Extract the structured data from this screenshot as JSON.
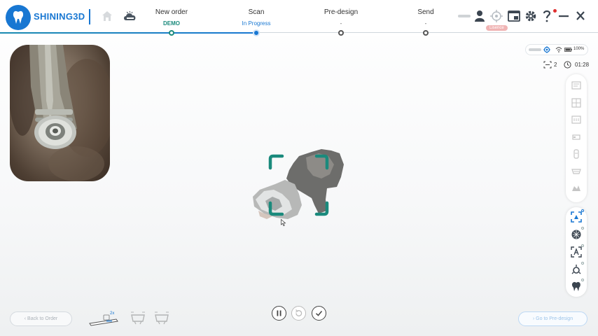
{
  "app": {
    "brand": "SHINING3D"
  },
  "steps": [
    {
      "title": "New order",
      "sub": "DEMO"
    },
    {
      "title": "Scan",
      "sub": "In Progress"
    },
    {
      "title": "Pre-design",
      "sub": "-"
    },
    {
      "title": "Send",
      "sub": "-"
    }
  ],
  "header": {
    "badge_text": "Lisence"
  },
  "status": {
    "battery_percent": "100%",
    "scan_count": "2",
    "timer": "01:28"
  },
  "scanner": {
    "zoom_level": "2x"
  },
  "buttons": {
    "back": "Back to Order",
    "next": "Go to Pre-design"
  },
  "colors": {
    "brand": "#1877d2",
    "accent_teal": "#1a8a7c",
    "scan_frame": "#1a8a7c"
  },
  "icons": {
    "topbar": [
      "home-icon",
      "cloud-icon",
      "device-icon",
      "user-icon",
      "calibration-icon",
      "screen-icon",
      "gear-icon",
      "help-icon",
      "minimize-icon",
      "close-icon"
    ],
    "toolbar_upper": [
      "mode1-icon",
      "mode2-icon",
      "mode3-icon",
      "mode4-icon",
      "mode5-icon",
      "mode6-icon",
      "mode7-icon"
    ],
    "toolbar_lower": [
      "scan-region-icon",
      "texture-icon",
      "text-scan-icon",
      "margin-icon",
      "tooth-icon"
    ]
  }
}
